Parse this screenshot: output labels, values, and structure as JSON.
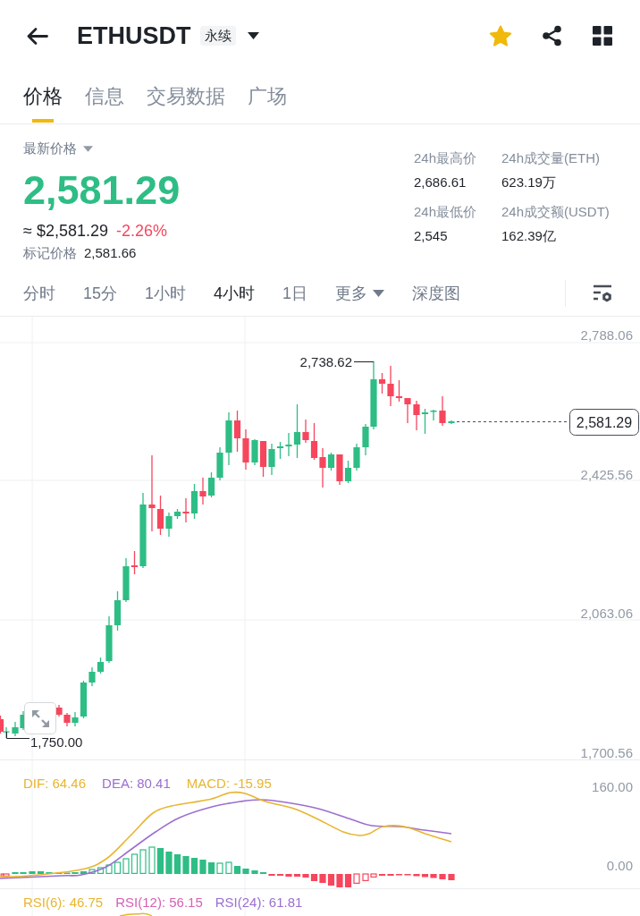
{
  "header": {
    "symbol": "ETHUSDT",
    "badge": "永续",
    "favorite": true
  },
  "tabs": [
    {
      "label": "价格",
      "selected": true
    },
    {
      "label": "信息",
      "selected": false
    },
    {
      "label": "交易数据",
      "selected": false
    },
    {
      "label": "广场",
      "selected": false
    }
  ],
  "price": {
    "label": "最新价格",
    "last": "2,581.29",
    "last_up": true,
    "usd": "≈ $2,581.29",
    "change": "-2.26%",
    "change_up": false,
    "mark_label": "标记价格",
    "mark_value": "2,581.66"
  },
  "stats": [
    {
      "label": "24h最高价",
      "value": "2,686.61"
    },
    {
      "label": "24h成交量(ETH)",
      "value": "623.19万"
    },
    {
      "label": "24h最低价",
      "value": "2,545"
    },
    {
      "label": "24h成交额(USDT)",
      "value": "162.39亿"
    }
  ],
  "intervals": [
    {
      "label": "分时",
      "kind": "option",
      "selected": false
    },
    {
      "label": "15分",
      "kind": "option",
      "selected": false
    },
    {
      "label": "1小时",
      "kind": "option",
      "selected": false
    },
    {
      "label": "4小时",
      "kind": "option",
      "selected": true
    },
    {
      "label": "1日",
      "kind": "option",
      "selected": false
    },
    {
      "label": "更多",
      "kind": "dropdown",
      "selected": false
    },
    {
      "label": "深度图",
      "kind": "option",
      "selected": false
    }
  ],
  "chart": {
    "price_ticks": [
      "2,788.06",
      "2,425.56",
      "2,063.06",
      "1,700.56"
    ],
    "high_label": "2,738.62",
    "low_label": "1,750.00",
    "current_price": "2,581.29"
  },
  "macd": {
    "indicators": [
      {
        "label": "DIF: 64.46",
        "color": "#e8b530"
      },
      {
        "label": "DEA: 80.41",
        "color": "#9b6fd0"
      },
      {
        "label": "MACD: -15.95",
        "color": "#e8b530"
      }
    ],
    "ticks": [
      "160.00",
      "0.00"
    ]
  },
  "rsi": {
    "indicators": [
      {
        "label": "RSI(6): 46.75",
        "color": "#e8b530"
      },
      {
        "label": "RSI(12): 56.15",
        "color": "#d760b5"
      },
      {
        "label": "RSI(24): 61.81",
        "color": "#9b6fd0"
      }
    ]
  }
}
